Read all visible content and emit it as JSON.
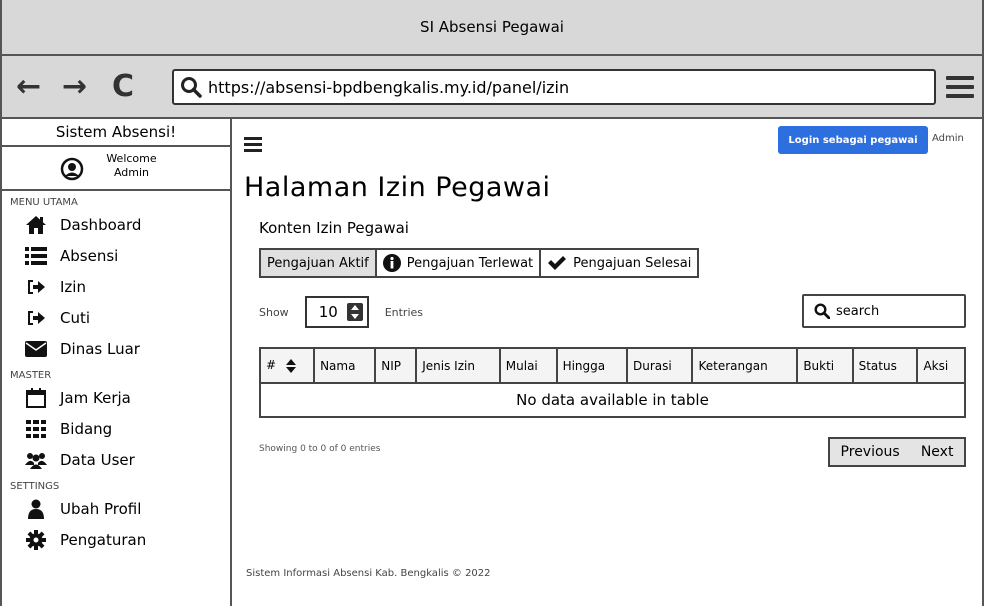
{
  "window": {
    "title": "SI Absensi Pegawai"
  },
  "browser": {
    "back": "←",
    "forward": "→",
    "reload": "C",
    "url": "https://absensi-bpdbengkalis.my.id/panel/izin"
  },
  "sidebar": {
    "title": "Sistem Absensi!",
    "welcome_line1": "Welcome",
    "welcome_line2": "Admin",
    "sections": [
      {
        "label": "MENU UTAMA"
      },
      {
        "label": "MASTER"
      },
      {
        "label": "SETTINGS"
      }
    ],
    "items": [
      {
        "label": "Dashboard",
        "icon": "home-icon"
      },
      {
        "label": "Absensi",
        "icon": "list-icon"
      },
      {
        "label": "Izin",
        "icon": "sign-in-icon"
      },
      {
        "label": "Cuti",
        "icon": "sign-in-icon"
      },
      {
        "label": "Dinas Luar",
        "icon": "envelope-icon"
      },
      {
        "label": "Jam Kerja",
        "icon": "calendar-icon"
      },
      {
        "label": "Bidang",
        "icon": "grid-icon"
      },
      {
        "label": "Data User",
        "icon": "users-icon"
      },
      {
        "label": "Ubah Profil",
        "icon": "user-icon"
      },
      {
        "label": "Pengaturan",
        "icon": "gear-icon"
      }
    ]
  },
  "header": {
    "login_button": "Login sebagai pegawai",
    "user": "Admin"
  },
  "main": {
    "page_title": "Halaman Izin Pegawai",
    "section_title": "Konten Izin Pegawai",
    "tabs": [
      {
        "label": "Pengajuan Aktif",
        "active": true
      },
      {
        "label": "Pengajuan Terlewat",
        "icon": "info-icon"
      },
      {
        "label": "Pengajuan Selesai",
        "icon": "check-icon"
      }
    ],
    "show_label": "Show",
    "entries_value": "10",
    "entries_label": "Entries",
    "search_placeholder": "search",
    "table": {
      "columns": [
        "#",
        "Nama",
        "NIP",
        "Jenis Izin",
        "Mulai",
        "Hingga",
        "Durasi",
        "Keterangan",
        "Bukti",
        "Status",
        "Aksi"
      ],
      "empty_message": "No data available in table"
    },
    "info": "Showing 0 to 0 of 0 entries",
    "pager": {
      "previous": "Previous",
      "next": "Next"
    },
    "footer": "Sistem Informasi Absensi Kab. Bengkalis © 2022"
  },
  "colors": {
    "accent": "#2e6fe0",
    "chrome": "#d8d8d8",
    "border": "#444444"
  }
}
